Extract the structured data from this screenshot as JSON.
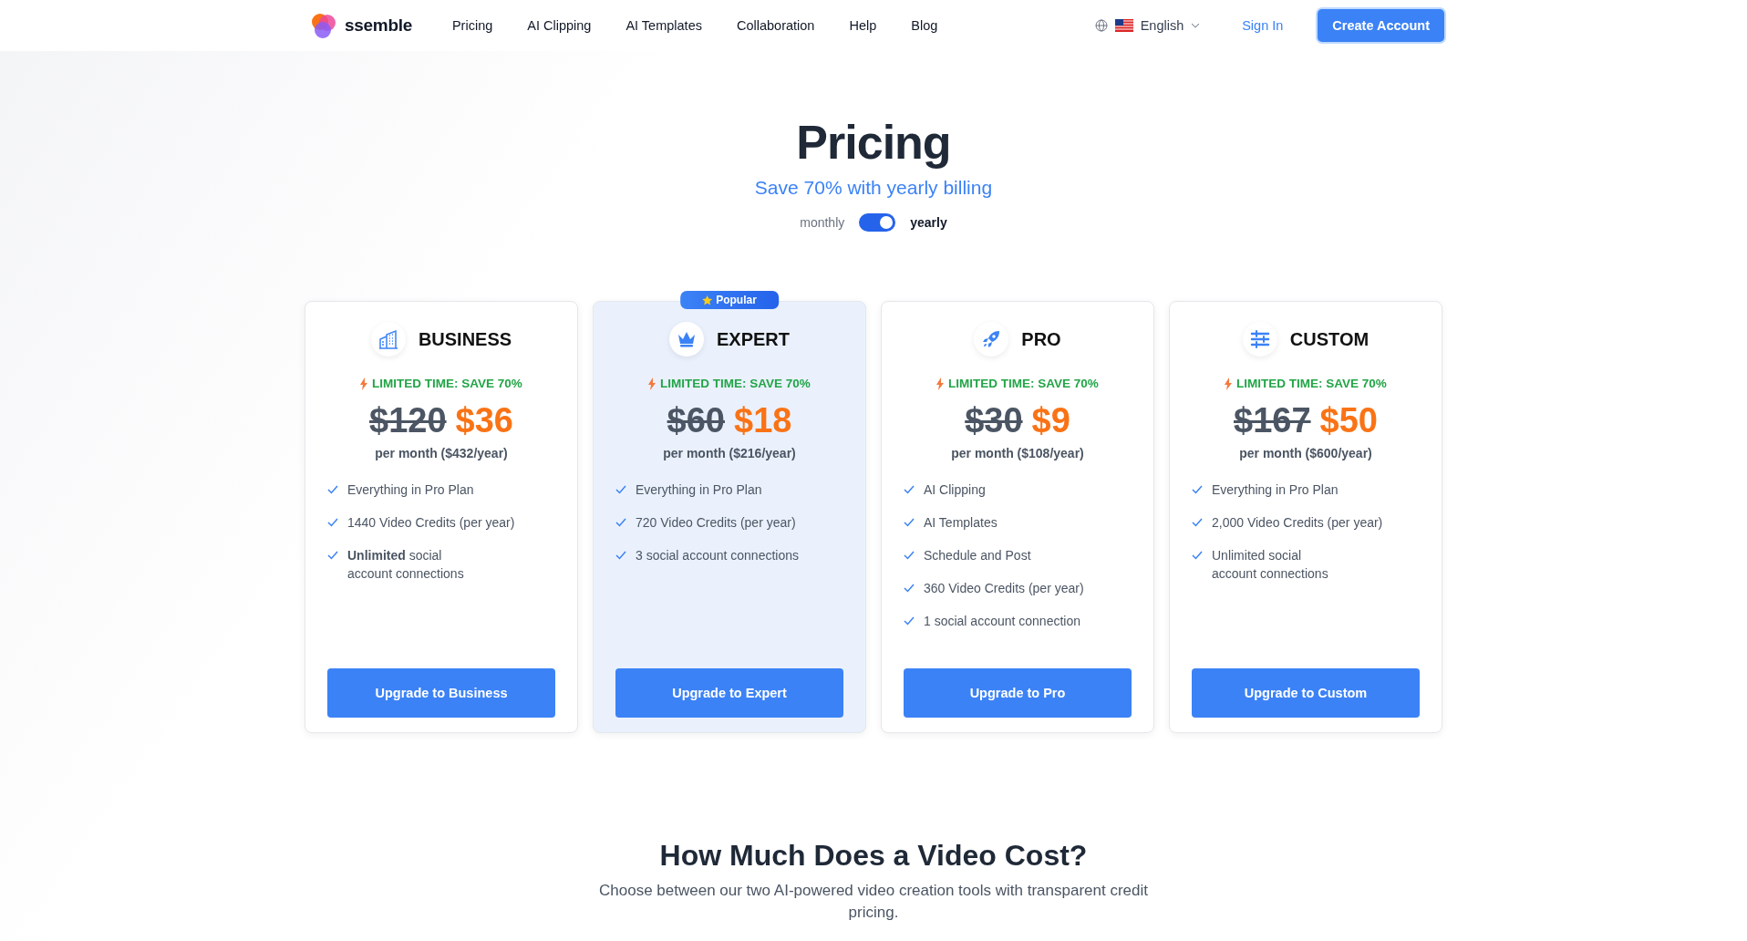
{
  "header": {
    "logo": "ssemble",
    "nav": [
      "Pricing",
      "AI Clipping",
      "AI Templates",
      "Collaboration",
      "Help",
      "Blog"
    ],
    "language": "English",
    "sign_in": "Sign In",
    "create_account": "Create Account"
  },
  "hero": {
    "title": "Pricing",
    "subtitle": "Save 70% with yearly billing",
    "billing": {
      "monthly_label": "monthly",
      "yearly_label": "yearly",
      "yearly": true
    }
  },
  "plans": [
    {
      "kind": "building",
      "name": "BUSINESS",
      "highlighted": false,
      "promo": "LIMITED TIME: SAVE 70%",
      "old_price": "$120",
      "price": "$36",
      "period": "per month ($432/year)",
      "features": [
        "Everything in Pro Plan",
        "1440 Video Credits (per year)",
        "**Unlimited** social\naccount connections"
      ],
      "button": "Upgrade to Business"
    },
    {
      "kind": "crown",
      "name": "EXPERT",
      "highlighted": true,
      "badge": "Popular",
      "promo": "LIMITED TIME: SAVE 70%",
      "old_price": "$60",
      "price": "$18",
      "period": "per month ($216/year)",
      "features": [
        "Everything in Pro Plan",
        "720 Video Credits (per year)",
        "3 social account connections"
      ],
      "button": "Upgrade to Expert"
    },
    {
      "kind": "rocket",
      "name": "PRO",
      "highlighted": false,
      "promo": "LIMITED TIME: SAVE 70%",
      "old_price": "$30",
      "price": "$9",
      "period": "per month ($108/year)",
      "features": [
        "AI Clipping",
        "AI Templates",
        "Schedule and Post",
        "360 Video Credits (per year)",
        "1 social account connection"
      ],
      "button": "Upgrade to Pro"
    },
    {
      "kind": "sliders",
      "name": "CUSTOM",
      "highlighted": false,
      "promo": "LIMITED TIME: SAVE 70%",
      "old_price": "$167",
      "price": "$50",
      "period": "per month ($600/year)",
      "features": [
        "Everything in Pro Plan",
        "2,000 Video Credits (per year)",
        "Unlimited social\naccount connections"
      ],
      "button": "Upgrade to Custom"
    }
  ],
  "cost_section": {
    "title": "How Much Does a Video Cost?",
    "text": "Choose between our two AI-powered video creation tools with transparent credit pricing."
  }
}
